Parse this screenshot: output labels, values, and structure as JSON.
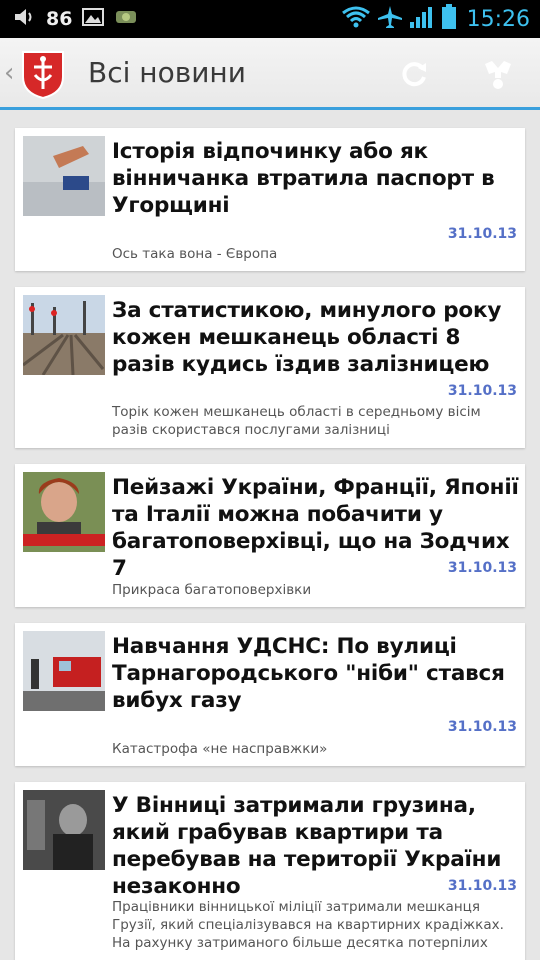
{
  "status_bar": {
    "volume_level": "86",
    "time": "15:26",
    "icons": [
      "volume-icon",
      "gallery-icon",
      "android-icon",
      "wifi-icon",
      "airplane-mode-icon",
      "signal-icon",
      "battery-icon"
    ]
  },
  "action_bar": {
    "title": "Всі новини",
    "icons": [
      "up-caret-icon",
      "vinnytsia-coat-of-arms-logo",
      "refresh-icon",
      "settings-icon"
    ]
  },
  "colors": {
    "action_bar_accent": "#3aa0dd",
    "date_color": "#5570c7",
    "time_color": "#3ec1ef"
  },
  "news": [
    {
      "title": "Історія відпочинку або як вінничанка втратила паспорт в Угорщині",
      "date": "31.10.13",
      "summary": "Ось така вона - Європа"
    },
    {
      "title": "За статистикою, минулого року кожен мешканець області 8 разів кудись їздив залізницею",
      "date": "31.10.13",
      "summary": "Торік кожен мешканець області в середньому вісім разів скористався послугами залізниці"
    },
    {
      "title": "Пейзажі України, Франції, Японії та Італії можна побачити у багатоповерхівці, що на Зодчих 7",
      "date": "31.10.13",
      "summary": "Прикраса багатоповерхівки"
    },
    {
      "title": "Навчання УДСНС: По вулиці Тарнагородського \"ніби\" стався вибух газу",
      "date": "31.10.13",
      "summary": "Катастрофа «не насправжки»"
    },
    {
      "title": "У Вінниці затримали грузина, який грабував квартири та перебував на території України незаконно",
      "date": "31.10.13",
      "summary": "Працівники вінницької міліції затримали мешканця Грузії, який спеціалізувався на квартирних крадіжках. На рахунку затриманого більше десятка потерпілих"
    }
  ]
}
